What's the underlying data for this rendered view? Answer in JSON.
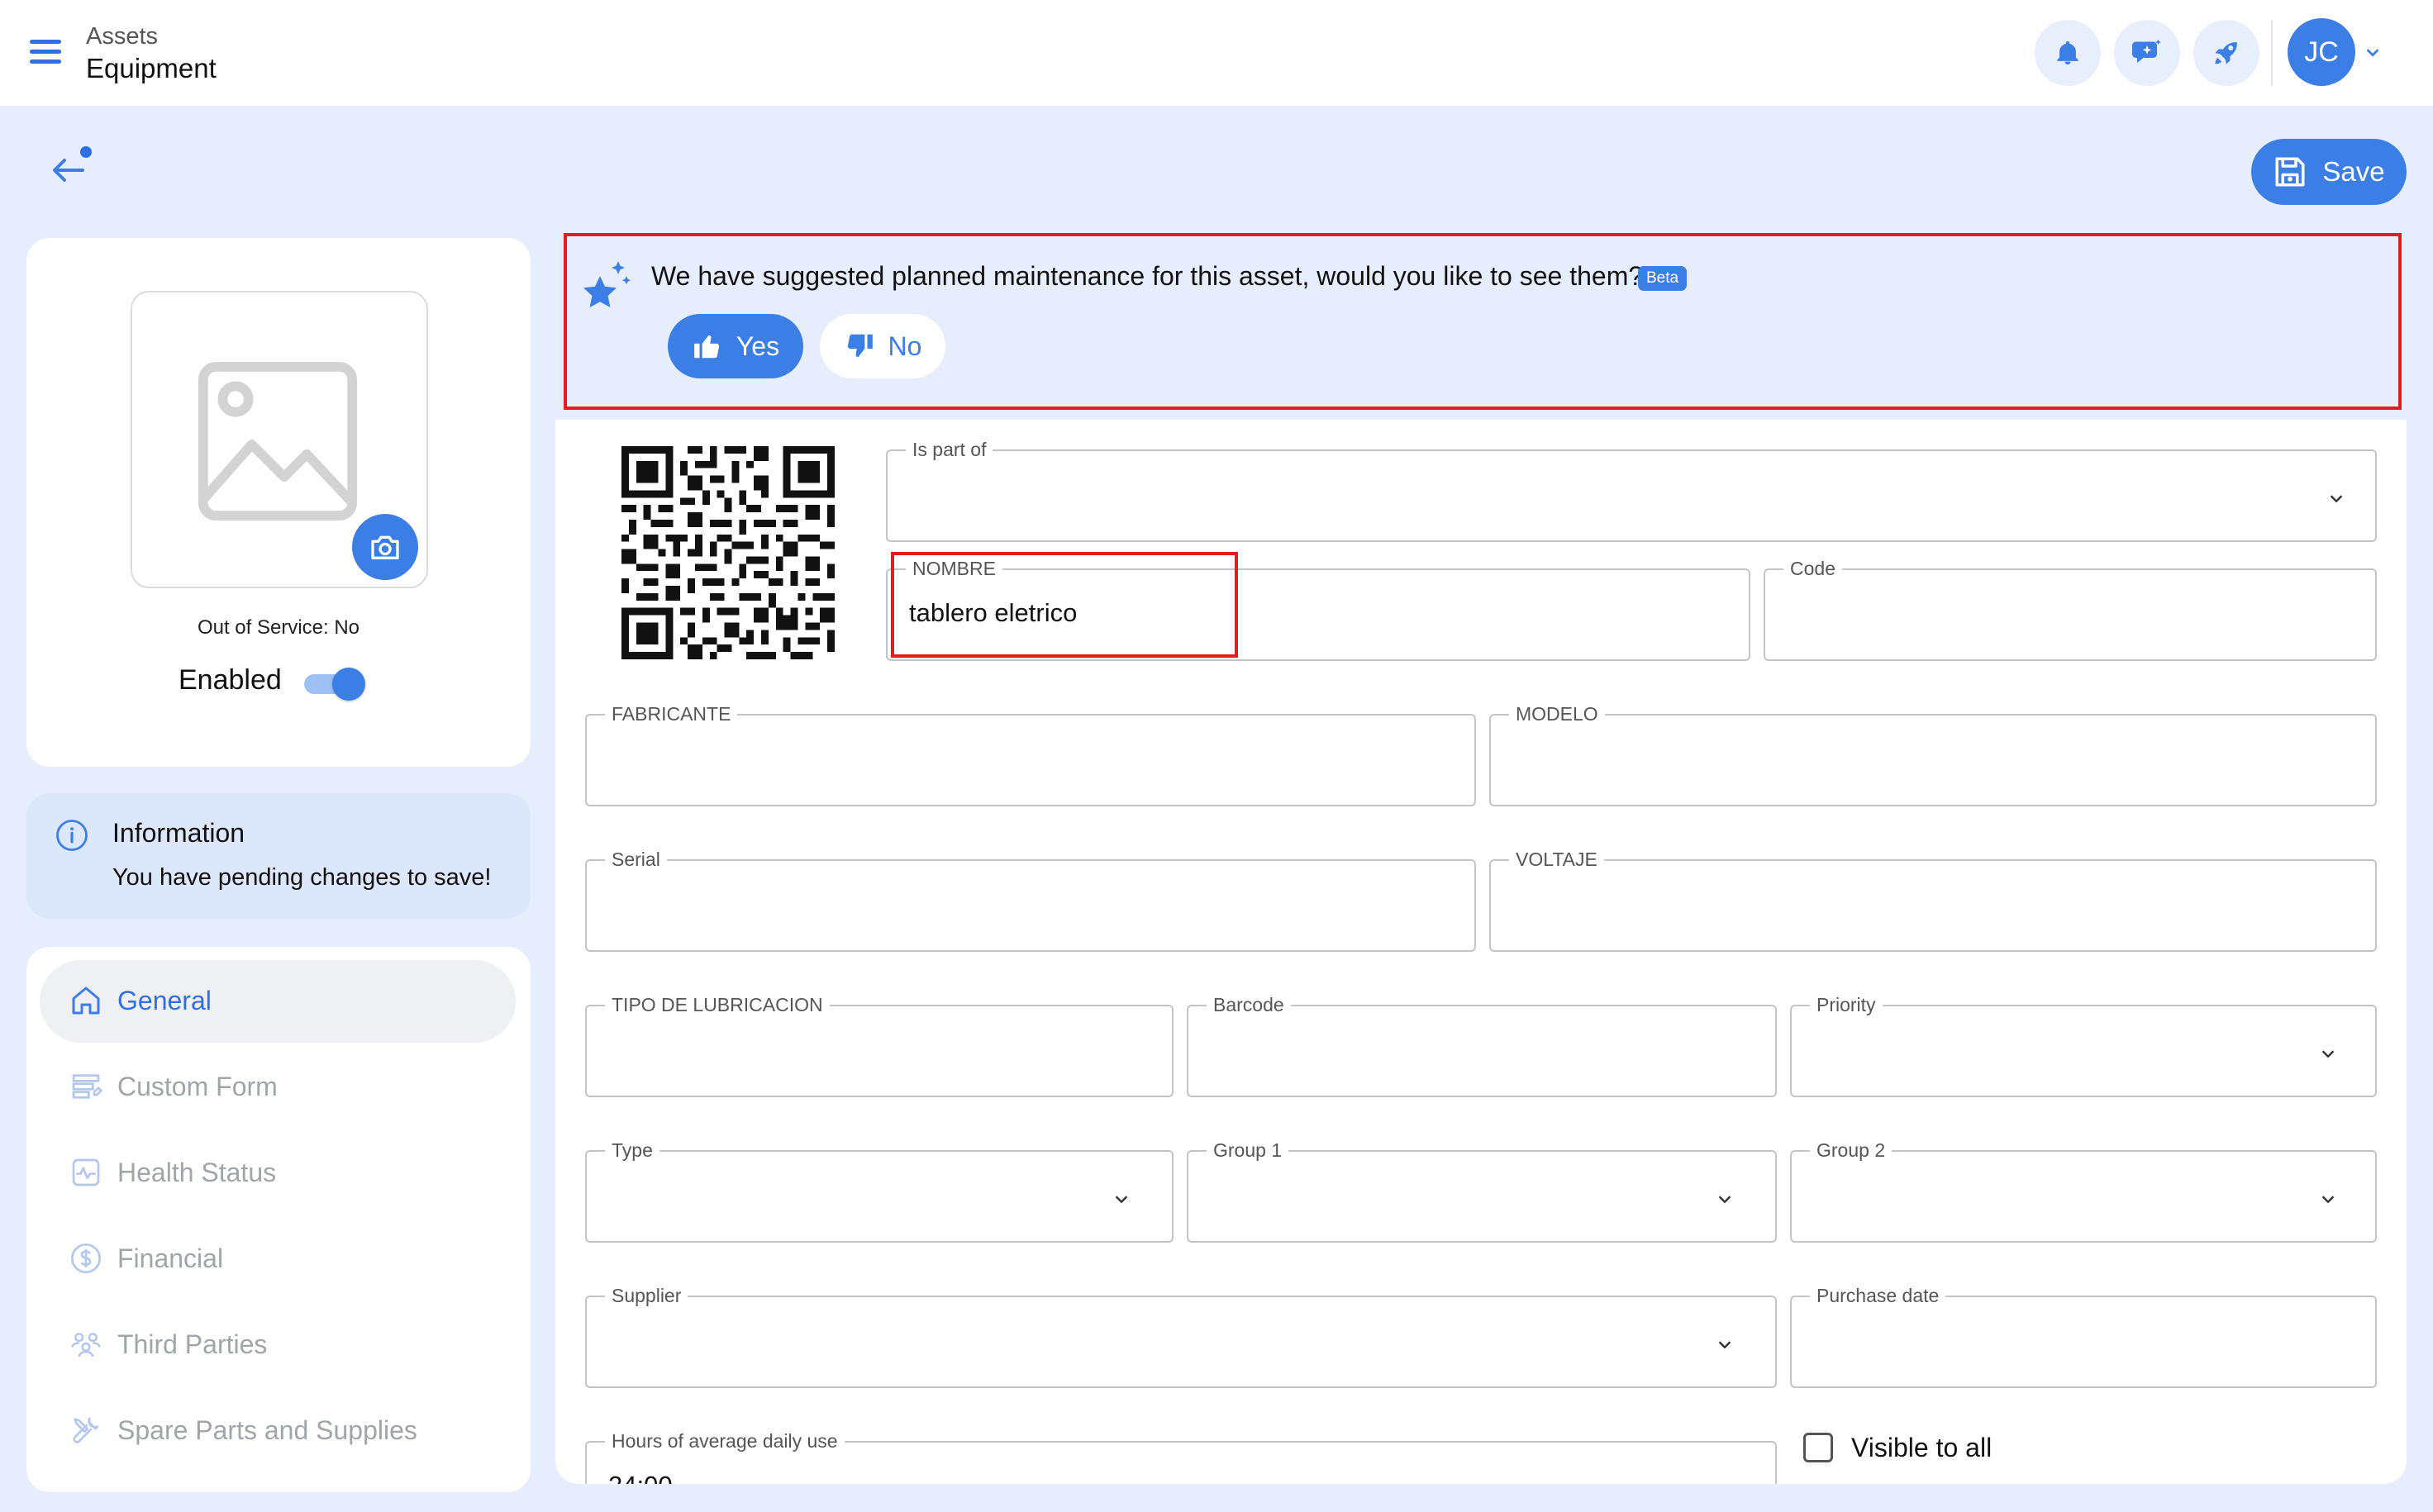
{
  "header": {
    "breadcrumb_parent": "Assets",
    "title": "Equipment",
    "avatar_initials": "JC",
    "accent_color": "#3b7fe6"
  },
  "toolbar": {
    "save_label": "Save"
  },
  "asset_card": {
    "out_of_service": "Out of Service: No",
    "enabled_label": "Enabled",
    "enabled": true
  },
  "info": {
    "title": "Information",
    "message": "You have pending changes to save!"
  },
  "nav": {
    "items": [
      {
        "label": "General",
        "icon": "home-icon",
        "active": true
      },
      {
        "label": "Custom Form",
        "icon": "form-icon",
        "active": false
      },
      {
        "label": "Health Status",
        "icon": "health-icon",
        "active": false
      },
      {
        "label": "Financial",
        "icon": "dollar-icon",
        "active": false
      },
      {
        "label": "Third Parties",
        "icon": "people-icon",
        "active": false
      },
      {
        "label": "Spare Parts and Supplies",
        "icon": "tools-icon",
        "active": false
      }
    ]
  },
  "suggestion": {
    "text": "We have suggested planned maintenance for this asset, would you like to see them?",
    "badge": "Beta",
    "yes_label": "Yes",
    "no_label": "No"
  },
  "form": {
    "is_part_of": {
      "label": "Is part of",
      "value": ""
    },
    "nombre": {
      "label": "NOMBRE",
      "value": "tablero eletrico"
    },
    "code": {
      "label": "Code",
      "value": ""
    },
    "fabricante": {
      "label": "FABRICANTE",
      "value": ""
    },
    "modelo": {
      "label": "MODELO",
      "value": ""
    },
    "serial": {
      "label": "Serial",
      "value": ""
    },
    "voltaje": {
      "label": "VOLTAJE",
      "value": ""
    },
    "tipo_lubricacion": {
      "label": "TIPO DE LUBRICACION",
      "value": ""
    },
    "barcode": {
      "label": "Barcode",
      "value": ""
    },
    "priority": {
      "label": "Priority",
      "value": ""
    },
    "type": {
      "label": "Type",
      "value": ""
    },
    "group1": {
      "label": "Group 1",
      "value": ""
    },
    "group2": {
      "label": "Group 2",
      "value": ""
    },
    "supplier": {
      "label": "Supplier",
      "value": ""
    },
    "purchase_date": {
      "label": "Purchase date",
      "value": ""
    },
    "hours_daily_use": {
      "label": "Hours of average daily use",
      "value": "24:00"
    },
    "visible_to_all": {
      "label": "Visible to all",
      "checked": false
    }
  }
}
